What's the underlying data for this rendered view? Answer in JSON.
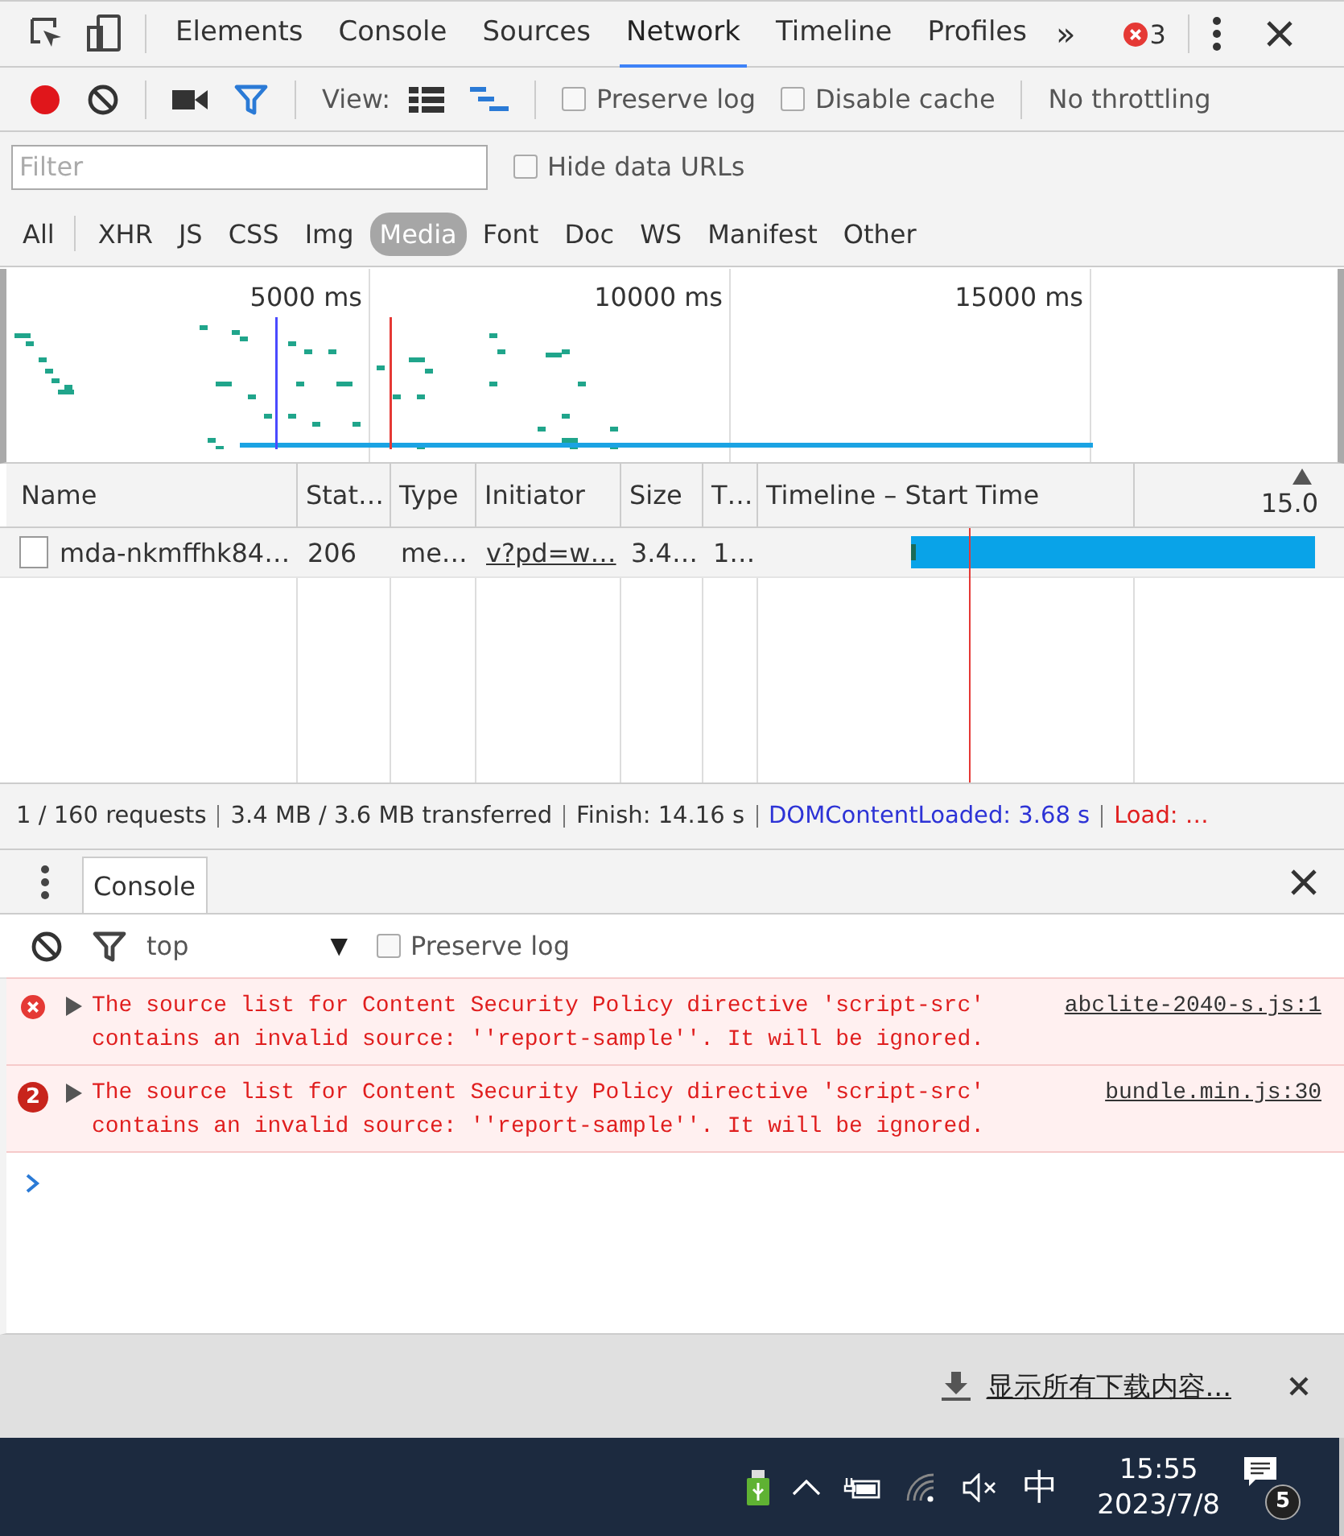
{
  "panel_tabs": [
    {
      "label": "Elements",
      "selected": false
    },
    {
      "label": "Console",
      "selected": false
    },
    {
      "label": "Sources",
      "selected": false
    },
    {
      "label": "Network",
      "selected": true
    },
    {
      "label": "Timeline",
      "selected": false
    },
    {
      "label": "Profiles",
      "selected": false
    }
  ],
  "more_tabs": "»",
  "error_count": "3",
  "network_toolbar": {
    "recording": true,
    "filter_active": true,
    "view_label": "View:",
    "preserve_log": {
      "label": "Preserve log",
      "checked": false
    },
    "disable_cache": {
      "label": "Disable cache",
      "checked": false
    },
    "throttling": "No throttling"
  },
  "filter": {
    "placeholder": "Filter",
    "hide_data_urls": {
      "label": "Hide data URLs",
      "checked": false
    }
  },
  "type_filters": [
    {
      "label": "All",
      "selected": false
    },
    {
      "label": "XHR",
      "selected": false
    },
    {
      "label": "JS",
      "selected": false
    },
    {
      "label": "CSS",
      "selected": false
    },
    {
      "label": "Img",
      "selected": false
    },
    {
      "label": "Media",
      "selected": true
    },
    {
      "label": "Font",
      "selected": false
    },
    {
      "label": "Doc",
      "selected": false
    },
    {
      "label": "WS",
      "selected": false
    },
    {
      "label": "Manifest",
      "selected": false
    },
    {
      "label": "Other",
      "selected": false
    }
  ],
  "overview": {
    "ticks": [
      "5000 ms",
      "10000 ms",
      "15000 ms"
    ]
  },
  "table": {
    "columns": [
      "Name",
      "Stat…",
      "Type",
      "Initiator",
      "Size",
      "T…",
      "Timeline – Start Time",
      "15.0"
    ],
    "rows": [
      {
        "cells": [
          "mda-nkmffhk84…",
          "206",
          "me…",
          "v?pd=w…",
          "3.4…",
          "1…"
        ]
      }
    ]
  },
  "summary": [
    {
      "kind": "plain",
      "text": "1 / 160 requests"
    },
    {
      "kind": "plain",
      "text": "3.4 MB / 3.6 MB transferred"
    },
    {
      "kind": "plain",
      "text": "Finish: 14.16 s"
    },
    {
      "kind": "dom",
      "text": "DOMContentLoaded: 3.68 s"
    },
    {
      "kind": "load",
      "text": "Load: …"
    }
  ],
  "drawer_tabs": [
    {
      "label": "Console",
      "selected": true
    }
  ],
  "console": {
    "context": "top",
    "context_arrow": "▼",
    "preserve_log": {
      "label": "Preserve log",
      "checked": false
    },
    "messages": [
      {
        "kind": "error",
        "text": "The source list for Content Security Policy directive 'script-src' contains an invalid source: ''report-sample''. It will be ignored.",
        "source": "abclite-2040-s.js:1"
      },
      {
        "kind": "repeated",
        "count": "2",
        "text": "The source list for Content Security Policy directive 'script-src' contains an invalid source: ''report-sample''. It will be ignored.",
        "source": "bundle.min.js:30"
      }
    ]
  },
  "download_bar": {
    "link": "显示所有下载内容..."
  },
  "taskbar": {
    "ime": "中",
    "time": "15:55",
    "date": "2023/7/8",
    "notifications": "5"
  }
}
